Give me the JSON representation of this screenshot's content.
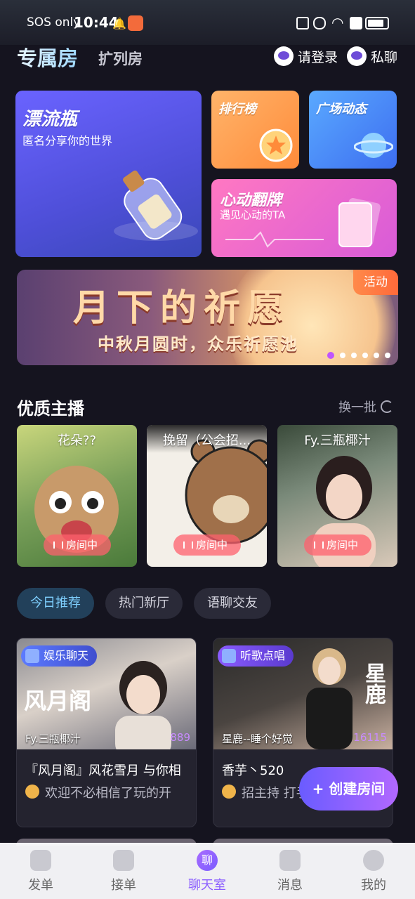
{
  "status_bar": {
    "carrier": "SOS only",
    "time": "10:44"
  },
  "header": {
    "tabs": [
      {
        "label": "专属房",
        "active": true
      },
      {
        "label": "扩列房",
        "active": false
      }
    ],
    "login_label": "请登录",
    "chat_label": "私聊"
  },
  "features": {
    "bottle": {
      "title": "漂流瓶",
      "subtitle": "匿名分享你的世界"
    },
    "rank": {
      "title": "排行榜"
    },
    "plaza": {
      "title": "广场动态"
    },
    "heart": {
      "title": "心动翻牌",
      "subtitle": "遇见心动的TA"
    }
  },
  "banner": {
    "title": "月下的祈愿",
    "subtitle": "中秋月圆时，众乐祈愿池",
    "badge": "活动",
    "slide_count": 6,
    "active_slide": 1
  },
  "hosts_section": {
    "title": "优质主播",
    "refresh_label": "换一批",
    "hosts": [
      {
        "name": "花朵??",
        "status": "房间中"
      },
      {
        "name": "挽留（公会招...",
        "status": "房间中"
      },
      {
        "name": "Fy.三瓶椰汁",
        "status": "房间中"
      }
    ]
  },
  "category_tabs": [
    {
      "label": "今日推荐",
      "active": true
    },
    {
      "label": "热门新厅",
      "active": false
    },
    {
      "label": "语聊交友",
      "active": false
    }
  ],
  "rooms": [
    {
      "tag": "娱乐聊天",
      "owner": "Fy.三瓶椰汁",
      "heat": "889",
      "title": "『风月阁』风花雪月 与你相",
      "desc": "欢迎不必相信了玩的开",
      "cover_text": "风月阁"
    },
    {
      "tag": "听歌点唱",
      "owner": "星鹿--睡个好觉",
      "heat": "16115",
      "title": "香芋丶520",
      "desc": "招主持 打手",
      "cover_text": "星鹿"
    }
  ],
  "create_room_label": "+ 创建房间",
  "bottom_nav": [
    {
      "label": "发单",
      "icon": "rocket-icon",
      "active": false
    },
    {
      "label": "接单",
      "icon": "swords-icon",
      "active": false
    },
    {
      "label": "聊天室",
      "icon": "chat-icon",
      "active": true,
      "icon_text": "聊"
    },
    {
      "label": "消息",
      "icon": "bell-icon",
      "active": false
    },
    {
      "label": "我的",
      "icon": "user-icon",
      "active": false
    }
  ]
}
